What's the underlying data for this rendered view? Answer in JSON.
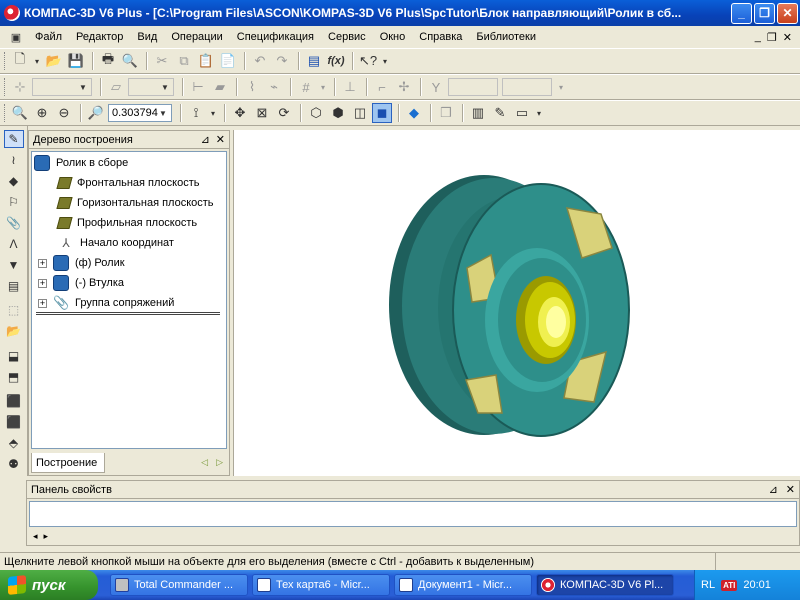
{
  "window": {
    "title": "КОМПАС-3D V6 Plus - [C:\\Program Files\\ASCON\\KOMPAS-3D V6 Plus\\SpcTutor\\Блок направляющий\\Ролик в сб...",
    "buttons": {
      "minimize": "_",
      "restore": "❐",
      "close": "✕"
    }
  },
  "menu": {
    "items": [
      "Файл",
      "Редактор",
      "Вид",
      "Операции",
      "Спецификация",
      "Сервис",
      "Окно",
      "Справка",
      "Библиотеки"
    ],
    "doc_controls": {
      "minimize": "_",
      "restore": "❐",
      "close": "✕"
    }
  },
  "toolbar3": {
    "zoom_value": "0.303794"
  },
  "tree_panel": {
    "header": "Дерево построения",
    "pin": "⊿",
    "close": "✕",
    "items": [
      {
        "label": "Ролик в сборе"
      },
      {
        "label": "Фронтальная плоскость"
      },
      {
        "label": "Горизонтальная плоскость"
      },
      {
        "label": "Профильная плоскость"
      },
      {
        "label": "Начало координат"
      },
      {
        "label": "(ф) Ролик",
        "expander": "+"
      },
      {
        "label": "(-) Втулка",
        "expander": "+"
      },
      {
        "label": "Группа сопряжений",
        "expander": "+"
      }
    ],
    "tab": "Построение",
    "nav_left": "◁",
    "nav_right": "▷"
  },
  "props_panel": {
    "header": "Панель свойств",
    "pin": "⊿",
    "close": "✕",
    "nav_left": "◂",
    "nav_right": "▸"
  },
  "status": {
    "text": "Щелкните левой кнопкой мыши на объекте для его выделения (вместе с Ctrl - добавить к выделенным)"
  },
  "taskbar": {
    "start": "пуск",
    "tasks": [
      {
        "label": "Total Commander ..."
      },
      {
        "label": "Тех карта6 - Micr..."
      },
      {
        "label": "Документ1 - Micr..."
      },
      {
        "label": "КОМПАС-3D V6 Pl..."
      }
    ],
    "lang": "RL",
    "ati": "ATI",
    "clock": "20:01"
  },
  "colors": {
    "model_body": "#2e8f8a",
    "model_dark": "#1e5f5c",
    "model_spokes": "#d9d27a",
    "bushing": "#c8c800"
  }
}
